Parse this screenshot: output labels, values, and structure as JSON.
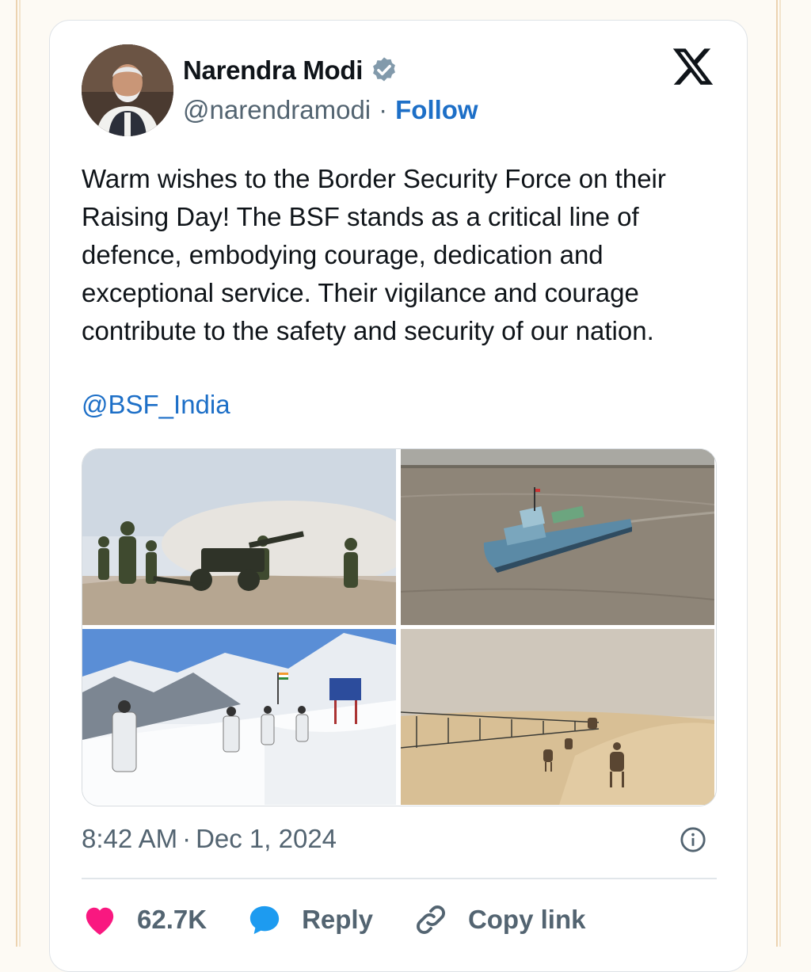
{
  "tweet": {
    "author_name": "Narendra Modi",
    "handle": "@narendramodi",
    "separator": "·",
    "follow_label": "Follow",
    "text": "Warm wishes to the Border Security Force on their Raising Day! The BSF stands as a critical line of defence, embodying courage, dedication and exceptional service. Their vigilance and courage contribute to the safety and security of our nation.",
    "mention": "@BSF_India",
    "time": "8:42 AM",
    "date": "Dec 1, 2024",
    "media": [
      {
        "subject": "soldiers firing artillery gun in snowy field"
      },
      {
        "subject": "BSF patrol boat on river"
      },
      {
        "subject": "soldiers patrolling snowy mountain post with Indian flag"
      },
      {
        "subject": "camel patrol along desert border fence"
      }
    ]
  },
  "actions": {
    "like_count": "62.7K",
    "reply_label": "Reply",
    "copy_link_label": "Copy link"
  },
  "icons": {
    "verified": "verified-badge-icon",
    "platform_logo": "x-logo-icon",
    "info": "info-icon",
    "like": "heart-icon",
    "reply": "speech-bubble-icon",
    "copy": "link-icon"
  },
  "colors": {
    "link_blue": "#1d6fc7",
    "heart_pink": "#f91880",
    "reply_blue": "#1d9bf0",
    "muted_text": "#536471"
  }
}
